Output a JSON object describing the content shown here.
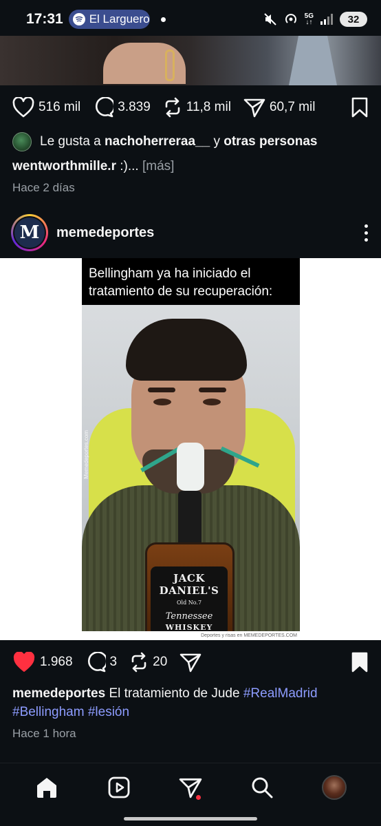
{
  "status_bar": {
    "time": "17:31",
    "media_label": "El Larguero",
    "network": "5G",
    "battery": "32"
  },
  "previous_post": {
    "likes": "516 mil",
    "comments": "3.839",
    "reposts": "11,8 mil",
    "shares": "60,7 mil",
    "liked_by_prefix": "Le gusta a",
    "liked_by_user": "nachoherreraa__",
    "liked_by_connector": "y",
    "liked_by_suffix": "otras personas",
    "caption_user": "wentworthmille.r",
    "caption_text": ":)...",
    "more_label": "[más]",
    "time_ago": "Hace 2 días"
  },
  "post": {
    "username": "memedeportes",
    "avatar_letter": "M",
    "meme_caption": "Bellingham ya ha iniciado el tratamiento de su recuperación:",
    "watermark": "Memedeportes.com",
    "footer_text": "Deportes y risas en MEMEDEPORTES.COM",
    "bottle_label": {
      "brand": "JACK DANIEL'S",
      "old_no": "Old No.7",
      "region": "Tennessee",
      "type": "WHISKEY"
    },
    "likes": "1.968",
    "comments": "3",
    "reposts": "20",
    "liked": true,
    "saved": true,
    "caption_user": "memedeportes",
    "caption_text": "El tratamiento de Jude",
    "hashtags": [
      "#RealMadrid",
      "#Bellingham",
      "#lesión"
    ],
    "time_ago": "Hace 1 hora"
  },
  "colors": {
    "background": "#0c1014",
    "like_red": "#ff3040",
    "hashtag": "#8d9cff",
    "muted": "#9aa0a6"
  },
  "nav": [
    "home-icon",
    "reels-icon",
    "messages-icon",
    "search-icon",
    "profile-avatar"
  ]
}
